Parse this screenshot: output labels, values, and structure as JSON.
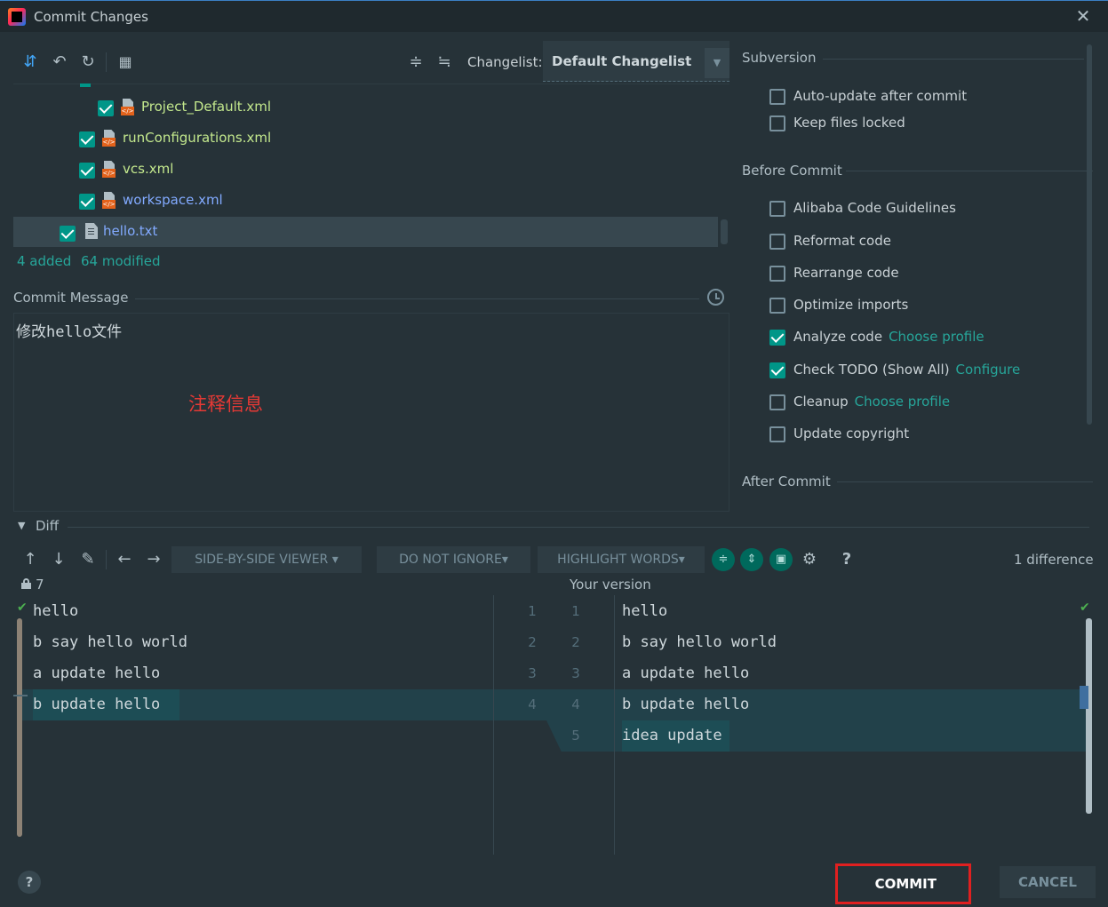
{
  "window": {
    "title": "Commit Changes"
  },
  "toolbar": {
    "changelist_label": "Changelist:",
    "changelist_value": "Default Changelist"
  },
  "files": [
    {
      "name": "Project_Default.xml",
      "status": "added",
      "checked": true
    },
    {
      "name": "runConfigurations.xml",
      "status": "added",
      "checked": true
    },
    {
      "name": "vcs.xml",
      "status": "added",
      "checked": true
    },
    {
      "name": "workspace.xml",
      "status": "modified",
      "checked": true
    },
    {
      "name": "hello.txt",
      "status": "modified",
      "checked": true
    }
  ],
  "summary": {
    "added": "4 added",
    "modified": "64 modified"
  },
  "commit_message": {
    "title": "Commit Message",
    "text": "修改hello文件",
    "annotation": "注释信息"
  },
  "subversion": {
    "title": "Subversion",
    "options": [
      {
        "label": "Auto-update after commit",
        "checked": false
      },
      {
        "label": "Keep files locked",
        "checked": false
      }
    ]
  },
  "before_commit": {
    "title": "Before Commit",
    "options": [
      {
        "label": "Alibaba Code Guidelines",
        "checked": false,
        "link": ""
      },
      {
        "label": "Reformat code",
        "checked": false,
        "link": ""
      },
      {
        "label": "Rearrange code",
        "checked": false,
        "link": ""
      },
      {
        "label": "Optimize imports",
        "checked": false,
        "link": ""
      },
      {
        "label": "Analyze code",
        "checked": true,
        "link": "Choose profile"
      },
      {
        "label": "Check TODO (Show All)",
        "checked": true,
        "link": "Configure"
      },
      {
        "label": "Cleanup",
        "checked": false,
        "link": "Choose profile"
      },
      {
        "label": "Update copyright",
        "checked": false,
        "link": ""
      }
    ]
  },
  "after_commit": {
    "title": "After Commit"
  },
  "diff": {
    "title": "Diff",
    "viewer": "SIDE-BY-SIDE VIEWER",
    "ignore": "DO NOT IGNORE",
    "highlight": "HIGHLIGHT WORDS",
    "help": "?",
    "difference_count": "1 difference",
    "left_revision": "7",
    "right_title": "Your version",
    "left_lines": [
      "hello",
      "b say hello world",
      "a update hello",
      "b update hello"
    ],
    "right_lines": [
      "hello",
      "b say hello world",
      "a update hello",
      "b update hello",
      "idea update"
    ],
    "left_numbers": [
      "1",
      "2",
      "3",
      "4"
    ],
    "right_numbers": [
      "1",
      "2",
      "3",
      "4",
      "5"
    ]
  },
  "buttons": {
    "commit": "COMMIT",
    "cancel": "CANCEL",
    "help": "?"
  },
  "colors": {
    "background": "#263238",
    "accent": "#009688",
    "added": "#c3e88d",
    "modified": "#82aaff",
    "link": "#26a69a",
    "highlight_box": "#e02020"
  },
  "icons": [
    "app-logo-icon",
    "close-icon",
    "diff-arrows-icon",
    "rollback-icon",
    "refresh-icon",
    "group-by-icon",
    "expand-all-icon",
    "collapse-all-icon",
    "history-icon",
    "settings-icon",
    "lock-icon"
  ]
}
